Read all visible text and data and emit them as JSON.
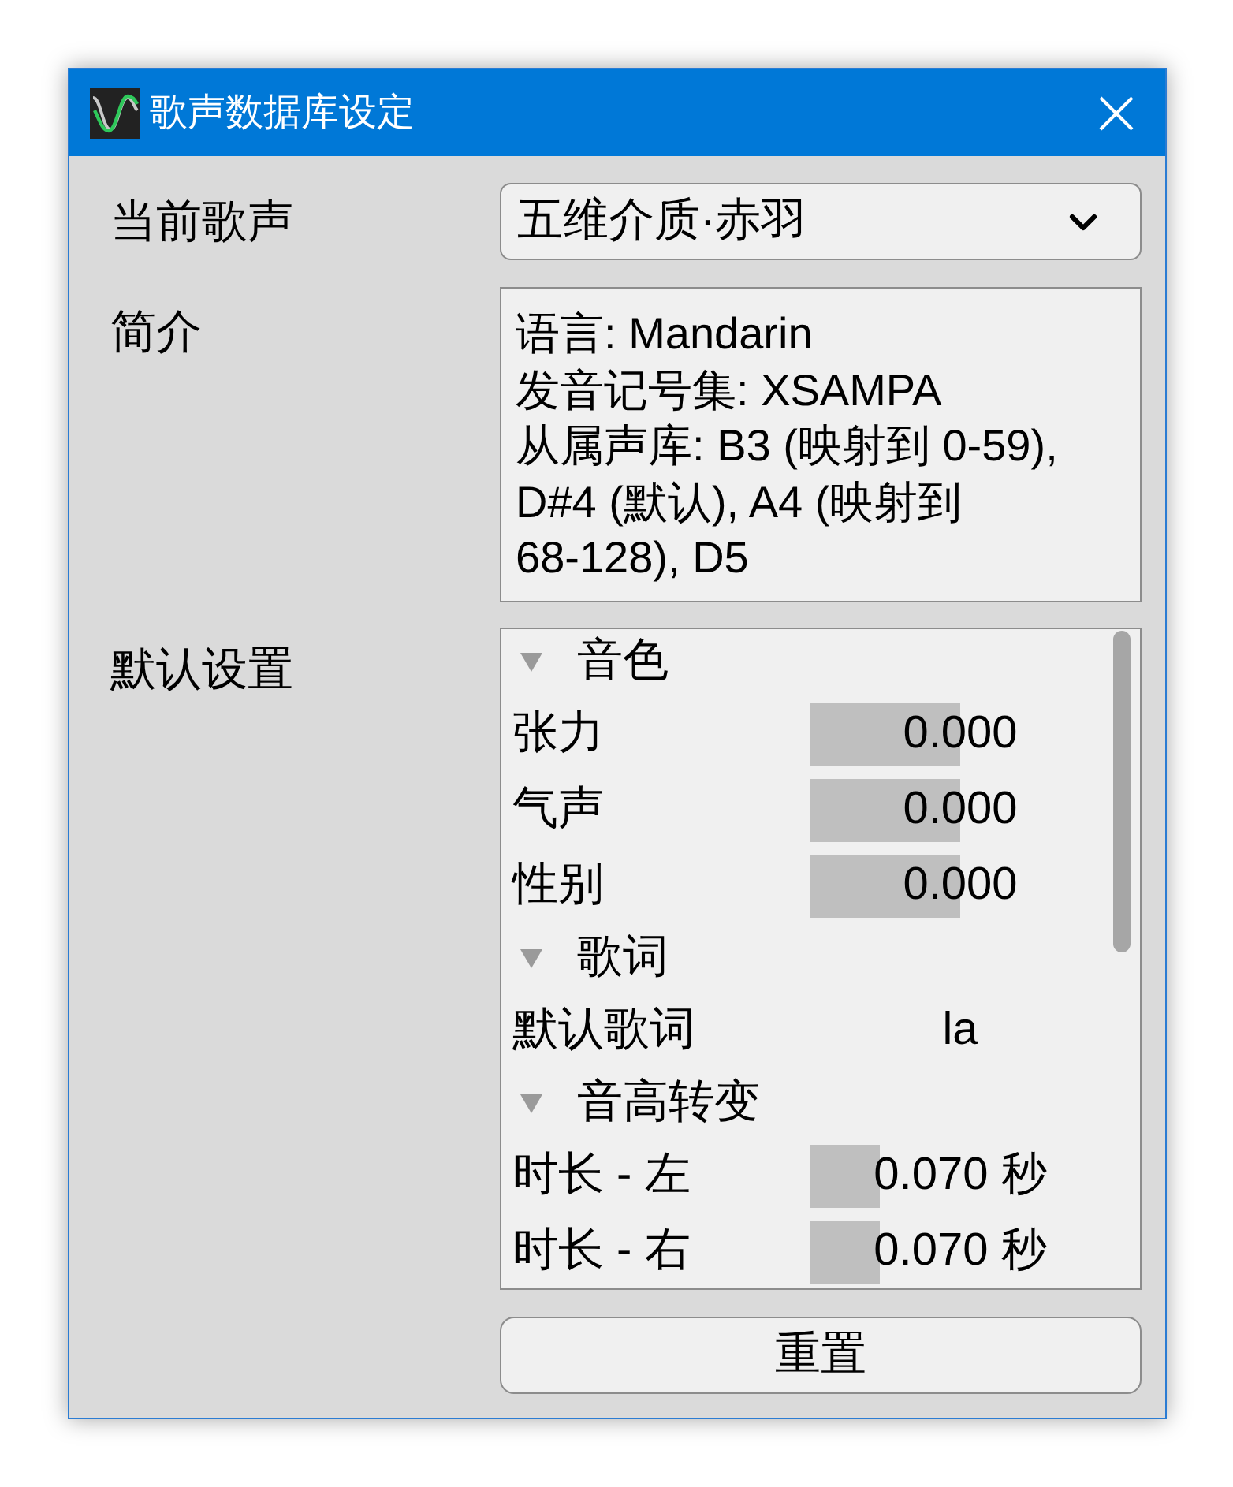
{
  "window": {
    "title": "歌声数据库设定"
  },
  "current_voice": {
    "label": "当前歌声",
    "value": "五维介质·赤羽"
  },
  "intro": {
    "label": "简介",
    "paragraphs": [
      "语言: Mandarin",
      "发音记号集: XSAMPA",
      "从属声库: B3 (映射到 0-59), D#4 (默认), A4 (映射到 68-128), D5"
    ]
  },
  "defaults": {
    "label": "默认设置",
    "groups": [
      {
        "title": "音色",
        "expanded": true,
        "items": [
          {
            "kind": "slider",
            "name": "张力",
            "value": "0.000",
            "level": 0.5
          },
          {
            "kind": "slider",
            "name": "气声",
            "value": "0.000",
            "level": 0.5
          },
          {
            "kind": "slider",
            "name": "性别",
            "value": "0.000",
            "level": 0.5
          }
        ]
      },
      {
        "title": "歌词",
        "expanded": true,
        "items": [
          {
            "kind": "text",
            "name": "默认歌词",
            "value": "la"
          }
        ]
      },
      {
        "title": "音高转变",
        "expanded": true,
        "items": [
          {
            "kind": "slider",
            "name": "时长 - 左",
            "value": "0.070 秒",
            "level": 0.23
          },
          {
            "kind": "slider",
            "name": "时长 - 右",
            "value": "0.070 秒",
            "level": 0.23
          }
        ]
      }
    ]
  },
  "reset_button": "重置"
}
